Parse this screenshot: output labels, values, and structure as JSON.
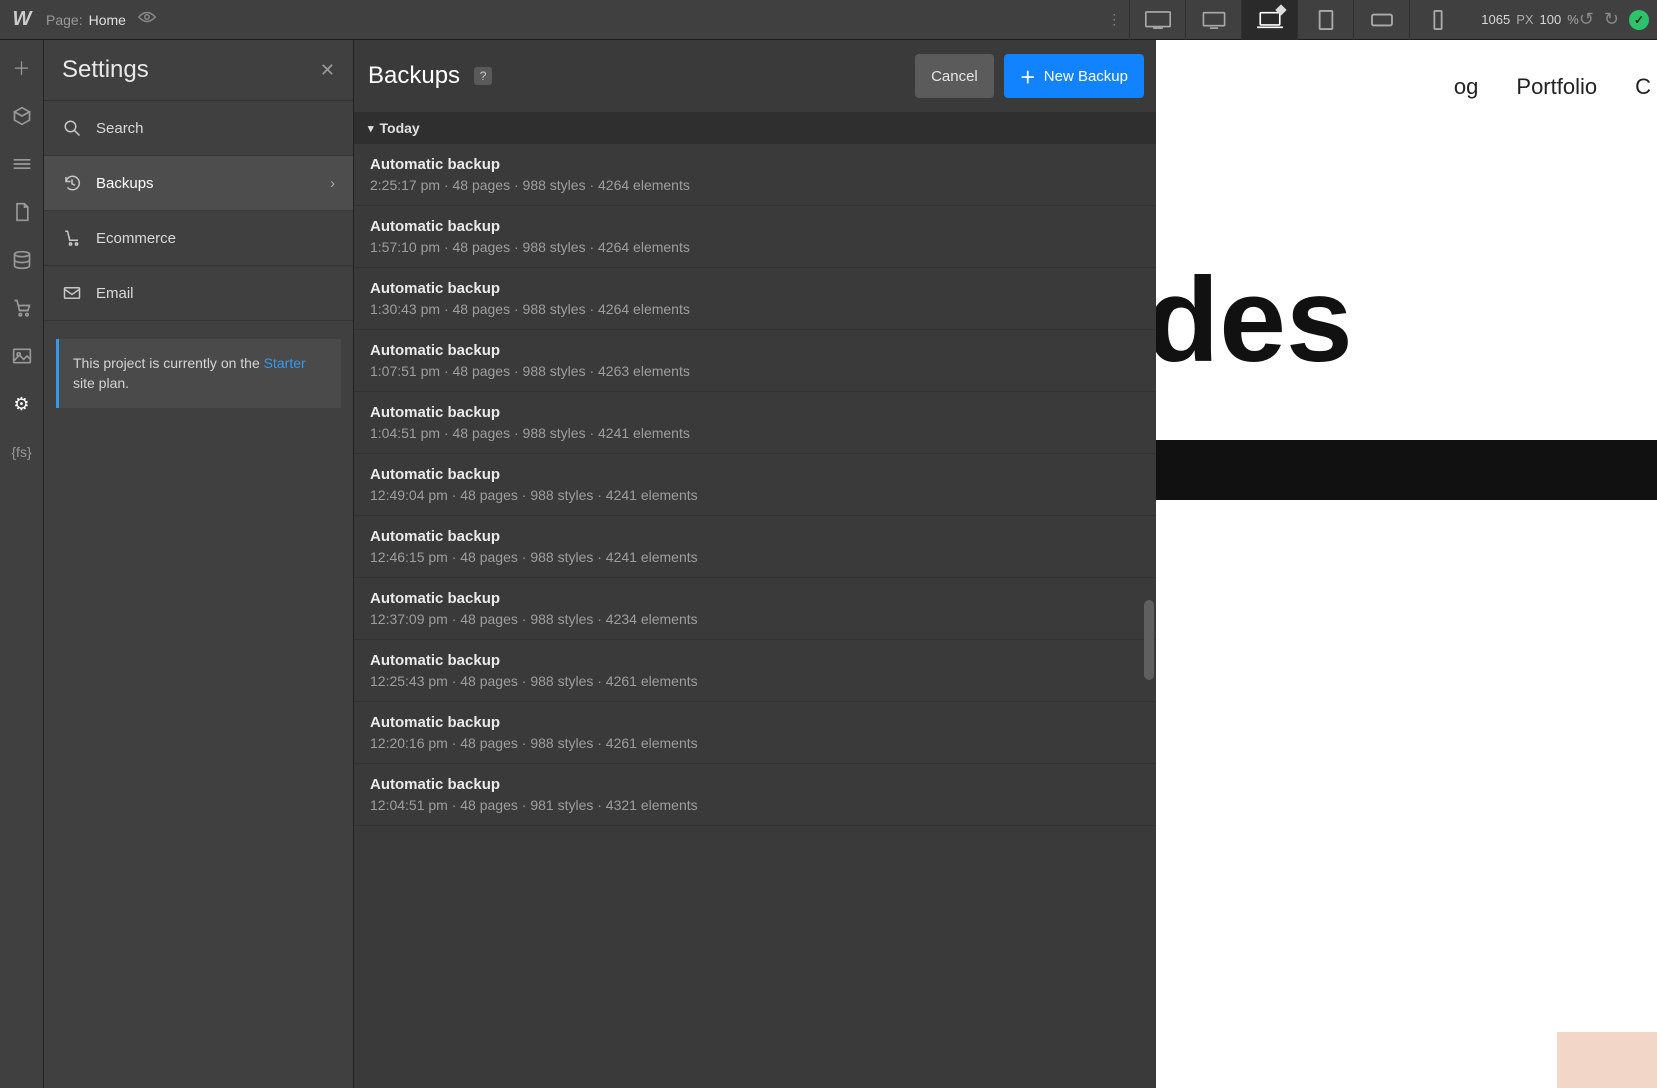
{
  "topbar": {
    "page_prefix": "Page:",
    "page_name": "Home",
    "width": "1065",
    "unit": "PX",
    "zoom": "100",
    "zoom_unit": "%"
  },
  "settings": {
    "title": "Settings",
    "items": [
      {
        "label": "Search",
        "icon": "search-icon"
      },
      {
        "label": "Backups",
        "icon": "history-icon"
      },
      {
        "label": "Ecommerce",
        "icon": "cart-icon"
      },
      {
        "label": "Email",
        "icon": "mail-icon"
      }
    ],
    "plan_notice_pre": "This project is currently on the ",
    "plan_notice_link": "Starter",
    "plan_notice_post": " site plan."
  },
  "backups": {
    "title": "Backups",
    "help": "?",
    "cancel": "Cancel",
    "new_backup": "New Backup",
    "section": "Today",
    "rows": [
      {
        "title": "Automatic backup",
        "meta": "2:25:17 pm · 48 pages · 988 styles · 4264 elements"
      },
      {
        "title": "Automatic backup",
        "meta": "1:57:10 pm · 48 pages · 988 styles · 4264 elements"
      },
      {
        "title": "Automatic backup",
        "meta": "1:30:43 pm · 48 pages · 988 styles · 4264 elements"
      },
      {
        "title": "Automatic backup",
        "meta": "1:07:51 pm · 48 pages · 988 styles · 4263 elements"
      },
      {
        "title": "Automatic backup",
        "meta": "1:04:51 pm · 48 pages · 988 styles · 4241 elements"
      },
      {
        "title": "Automatic backup",
        "meta": "12:49:04 pm · 48 pages · 988 styles · 4241 elements"
      },
      {
        "title": "Automatic backup",
        "meta": "12:46:15 pm · 48 pages · 988 styles · 4241 elements"
      },
      {
        "title": "Automatic backup",
        "meta": "12:37:09 pm · 48 pages · 988 styles · 4234 elements"
      },
      {
        "title": "Automatic backup",
        "meta": "12:25:43 pm · 48 pages · 988 styles · 4261 elements"
      },
      {
        "title": "Automatic backup",
        "meta": "12:20:16 pm · 48 pages · 988 styles · 4261 elements"
      },
      {
        "title": "Automatic backup",
        "meta": "12:04:51 pm · 48 pages · 981 styles · 4321 elements"
      }
    ]
  },
  "canvas": {
    "nav1_fragment": "og",
    "nav2": "Portfolio",
    "nav3_fragment": "C",
    "hero_fragment": "des"
  }
}
